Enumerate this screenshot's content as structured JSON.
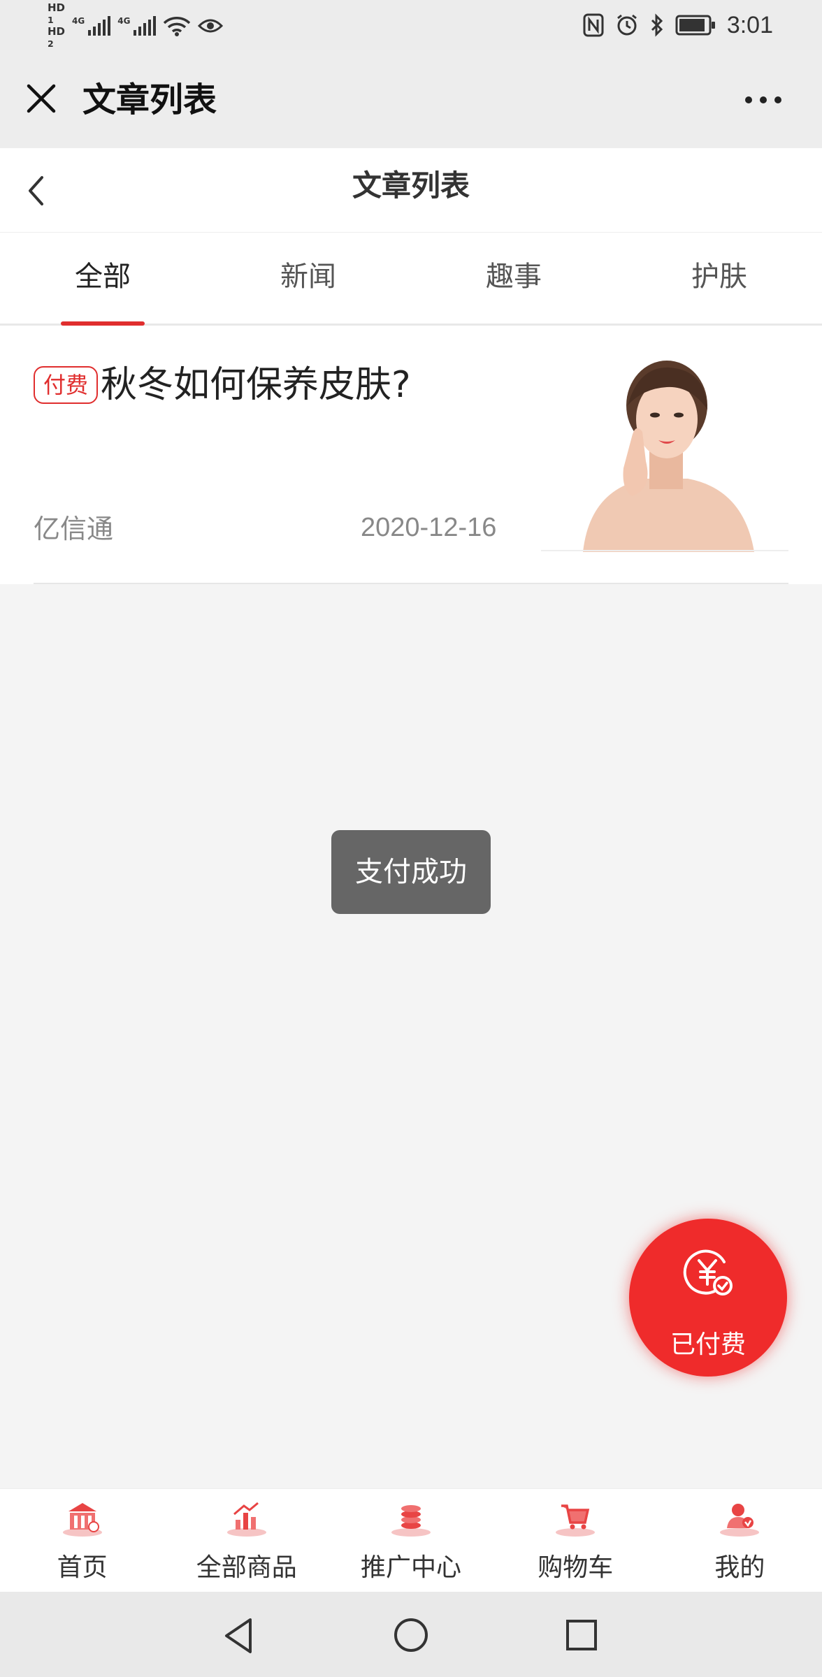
{
  "status_bar": {
    "sim1": [
      "HD",
      "1"
    ],
    "sim2": [
      "HD",
      "2"
    ],
    "network1": "4G",
    "network2": "4G",
    "time": "3:01"
  },
  "miniprogram_header": {
    "title": "文章列表",
    "close_icon": "close-icon",
    "more_icon": "more-icon"
  },
  "page_nav": {
    "title": "文章列表",
    "back_icon": "chevron-left-icon"
  },
  "tabs": [
    {
      "label": "全部",
      "active": true
    },
    {
      "label": "新闻",
      "active": false
    },
    {
      "label": "趣事",
      "active": false
    },
    {
      "label": "护肤",
      "active": false
    }
  ],
  "article": {
    "tag": "付费",
    "title": "秋冬如何保养皮肤?",
    "author": "亿信通",
    "date": "2020-12-16",
    "image": "woman-portrait"
  },
  "toast": "支付成功",
  "fab": {
    "label": "已付费",
    "icon": "yuan-check-icon",
    "color": "#ef2b2b"
  },
  "tabbar": [
    {
      "label": "首页",
      "icon": "home-bank-icon"
    },
    {
      "label": "全部商品",
      "icon": "products-icon"
    },
    {
      "label": "推广中心",
      "icon": "coins-icon"
    },
    {
      "label": "购物车",
      "icon": "cart-icon"
    },
    {
      "label": "我的",
      "icon": "user-icon"
    }
  ],
  "colors": {
    "accent": "#e02e2e",
    "background": "#f4f4f4"
  }
}
